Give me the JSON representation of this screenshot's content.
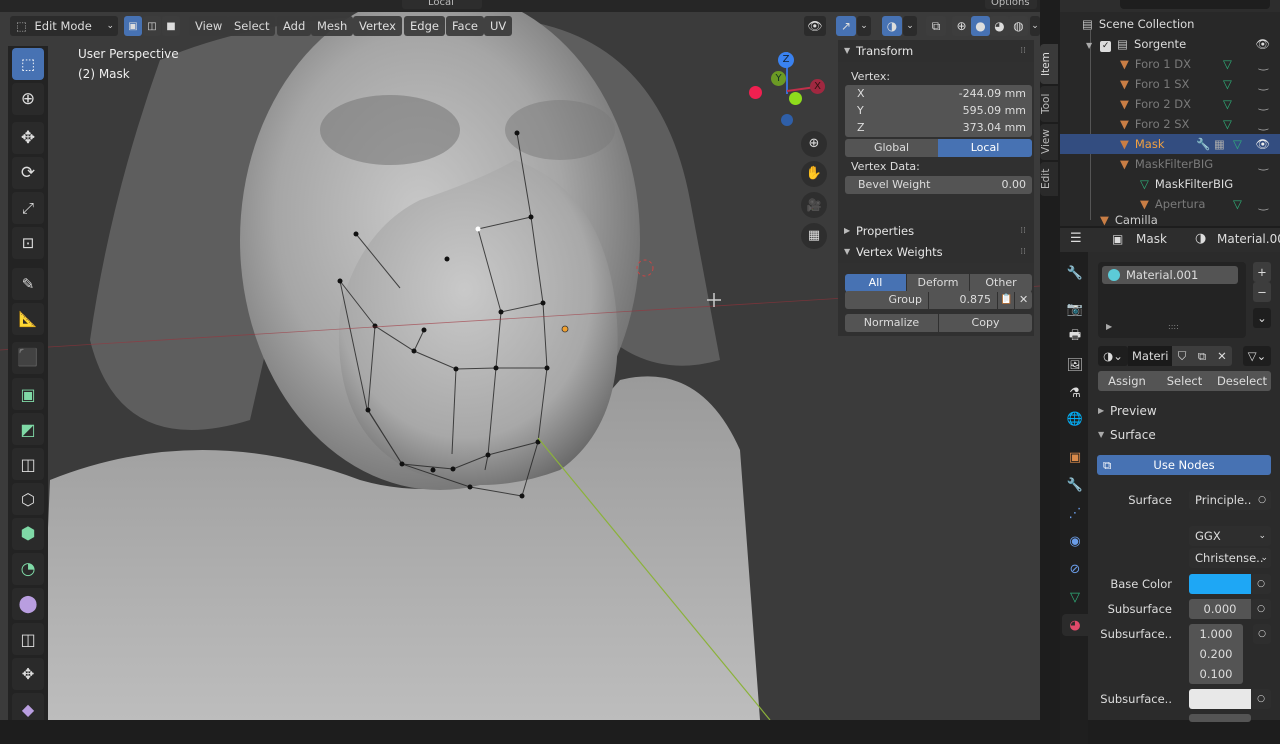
{
  "header": {
    "mode_selector": "Edit Mode",
    "menus": [
      "View",
      "Select",
      "Add",
      "Mesh",
      "Vertex",
      "Edge",
      "Face",
      "UV"
    ],
    "top_partial": {
      "orientation": "Local",
      "options": "Options",
      "axes": [
        "X",
        "Y",
        "Z"
      ]
    }
  },
  "viewport": {
    "view_name": "User Perspective",
    "object_info": "(2) Mask",
    "gizmo_axes": [
      "Z",
      "Y",
      "X"
    ]
  },
  "toolbar": {
    "tools": [
      "select-box",
      "cursor",
      "move",
      "rotate",
      "scale",
      "transform",
      "annotate",
      "measure",
      "add-cube",
      "inset-faces",
      "bevel",
      "loop-cut",
      "knife",
      "poly-build",
      "spin",
      "smooth",
      "edge-slide",
      "shrink-fatten",
      "shear"
    ]
  },
  "npanel": {
    "tabs": [
      "Item",
      "Tool",
      "View",
      "Edit"
    ],
    "transform": {
      "title": "Transform",
      "vertex_label": "Vertex:",
      "x_label": "X",
      "x_value": "-244.09 mm",
      "y_label": "Y",
      "y_value": "595.09 mm",
      "z_label": "Z",
      "z_value": "373.04 mm",
      "global": "Global",
      "local": "Local",
      "vertex_data_label": "Vertex Data:",
      "bevel_label": "Bevel Weight",
      "bevel_value": "0.00"
    },
    "properties_title": "Properties",
    "vertex_weights": {
      "title": "Vertex Weights",
      "all": "All",
      "deform": "Deform",
      "other": "Other",
      "group_label": "Group",
      "group_value": "0.875",
      "normalize": "Normalize",
      "copy": "Copy"
    }
  },
  "outliner": {
    "root": "Scene Collection",
    "items": [
      {
        "name": "Sorgente",
        "visible": true
      },
      {
        "name": "Foro 1 DX",
        "visible": false
      },
      {
        "name": "Foro 1 SX",
        "visible": false
      },
      {
        "name": "Foro 2 DX",
        "visible": false
      },
      {
        "name": "Foro 2 SX",
        "visible": false
      },
      {
        "name": "Mask",
        "visible": true,
        "selected": true
      },
      {
        "name": "MaskFilterBIG",
        "visible": false
      },
      {
        "name": "MaskFilterBIG",
        "visible": null
      },
      {
        "name": "Apertura",
        "visible": false
      },
      {
        "name": "Camilla",
        "visible": true
      }
    ]
  },
  "properties": {
    "object_name": "Mask",
    "material_name": "Material.00",
    "slot_name": "Material.001",
    "material_field": "Materi",
    "assign": "Assign",
    "select": "Select",
    "deselect": "Deselect",
    "preview": "Preview",
    "surface_section": "Surface",
    "use_nodes": "Use Nodes",
    "surface_label": "Surface",
    "surface_value": "Principle..",
    "distribution": "GGX",
    "subsurface_method": "Christense..",
    "base_color_label": "Base Color",
    "base_color": "#1ea7f5",
    "subsurface_label": "Subsurface",
    "subsurface_value": "0.000",
    "subsurface_radius_label": "Subsurface..",
    "subsurface_radius": [
      "1.000",
      "0.200",
      "0.100"
    ],
    "subsurface_color_label": "Subsurface..",
    "subsurface_color": "#e8e8e8"
  },
  "colors": {
    "accent": "#4772b3",
    "selected_text": "#f0a040",
    "mesh_icon": "#3fcf8e",
    "object_icon": "#d98a4a"
  }
}
